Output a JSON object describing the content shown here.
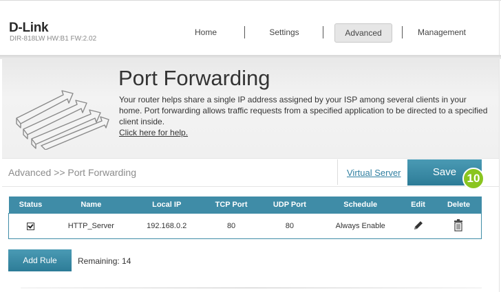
{
  "brand": {
    "logo": "D-Link",
    "model_info": "DIR-818LW   HW:B1   FW:2.02"
  },
  "nav": {
    "items": [
      "Home",
      "Settings",
      "Advanced",
      "Management"
    ],
    "active": "Advanced"
  },
  "banner": {
    "title": "Port Forwarding",
    "description": "Your router helps share a single IP address assigned by your ISP among several clients in your home. Port forwarding allows traffic requests from a specified application to be directed to a specified client inside.",
    "help_link": "Click here for help."
  },
  "breadcrumb": "Advanced >> Port Forwarding",
  "actions": {
    "virtual_server": "Virtual Server",
    "save": "Save",
    "step_badge": "10"
  },
  "table": {
    "headers": [
      "Status",
      "Name",
      "Local IP",
      "TCP Port",
      "UDP Port",
      "Schedule",
      "Edit",
      "Delete"
    ],
    "rows": [
      {
        "status_checked": true,
        "name": "HTTP_Server",
        "local_ip": "192.168.0.2",
        "tcp_port": "80",
        "udp_port": "80",
        "schedule": "Always Enable",
        "edit_icon": "pencil-icon",
        "delete_icon": "trash-icon"
      }
    ]
  },
  "footer": {
    "add_rule": "Add Rule",
    "remaining": "Remaining: 14"
  },
  "colors": {
    "accent": "#3f8ca7",
    "badge": "#8ac51f",
    "link": "#2f7fa0"
  }
}
